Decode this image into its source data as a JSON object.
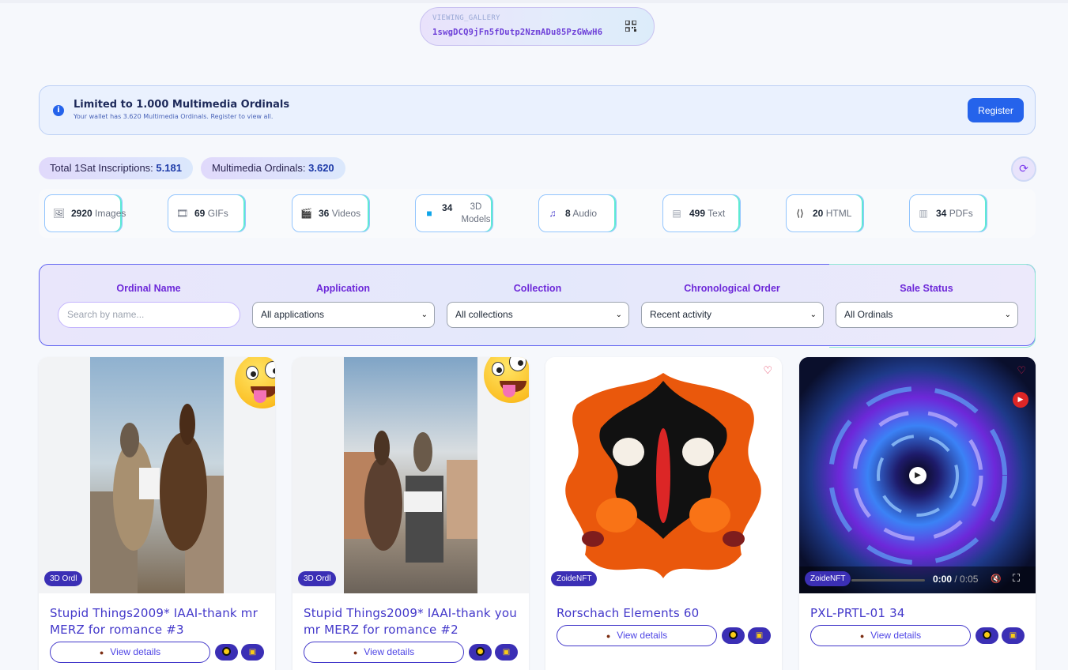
{
  "wallet": {
    "label": "VIEWING_GALLERY",
    "address": "1swgDCQ9jFn5fDutp2NzmADu85PzGWwH6"
  },
  "notice": {
    "title": "Limited to 1.000 Multimedia Ordinals",
    "subtitle": "Your wallet has 3.620 Multimedia Ordinals. Register to view all.",
    "register_label": "Register"
  },
  "totals": {
    "inscriptions_label": "Total 1Sat Inscriptions:",
    "inscriptions_value": "5.181",
    "multimedia_label": "Multimedia Ordinals:",
    "multimedia_value": "3.620"
  },
  "categories": [
    {
      "count": "2920",
      "label": "Images",
      "icon": "image-icon"
    },
    {
      "count": "69",
      "label": "GIFs",
      "icon": "gif-icon"
    },
    {
      "count": "36",
      "label": "Videos",
      "icon": "video-icon"
    },
    {
      "count": "34",
      "label": "3D Models",
      "icon": "cube-icon"
    },
    {
      "count": "8",
      "label": "Audio",
      "icon": "music-icon"
    },
    {
      "count": "499",
      "label": "Text",
      "icon": "text-icon"
    },
    {
      "count": "20",
      "label": "HTML",
      "icon": "code-icon"
    },
    {
      "count": "34",
      "label": "PDFs",
      "icon": "pdf-icon"
    }
  ],
  "filters": {
    "name_label": "Ordinal Name",
    "name_placeholder": "Search by name...",
    "application_label": "Application",
    "application_value": "All applications",
    "collection_label": "Collection",
    "collection_value": "All collections",
    "order_label": "Chronological Order",
    "order_value": "Recent activity",
    "sale_label": "Sale Status",
    "sale_value": "All Ordinals"
  },
  "cards": [
    {
      "tag": "3D Ordl",
      "title": "Stupid Things2009* IAAI-thank mr MERZ for romance #3",
      "view_label": "View details"
    },
    {
      "tag": "3D Ordl",
      "title": "Stupid Things2009* IAAI-thank you mr MERZ for romance #2",
      "view_label": "View details"
    },
    {
      "tag": "ZoideNFT",
      "title": "Rorschach Elements 60",
      "view_label": "View details"
    },
    {
      "tag": "ZoideNFT",
      "title": "PXL-PRTL-01 34",
      "view_label": "View details"
    }
  ],
  "video": {
    "current": "0:00",
    "duration": "/ 0:05"
  },
  "colors": {
    "accent": "#4338ca",
    "primary": "#2563eb",
    "tag_bg": "#3b2fb5"
  }
}
